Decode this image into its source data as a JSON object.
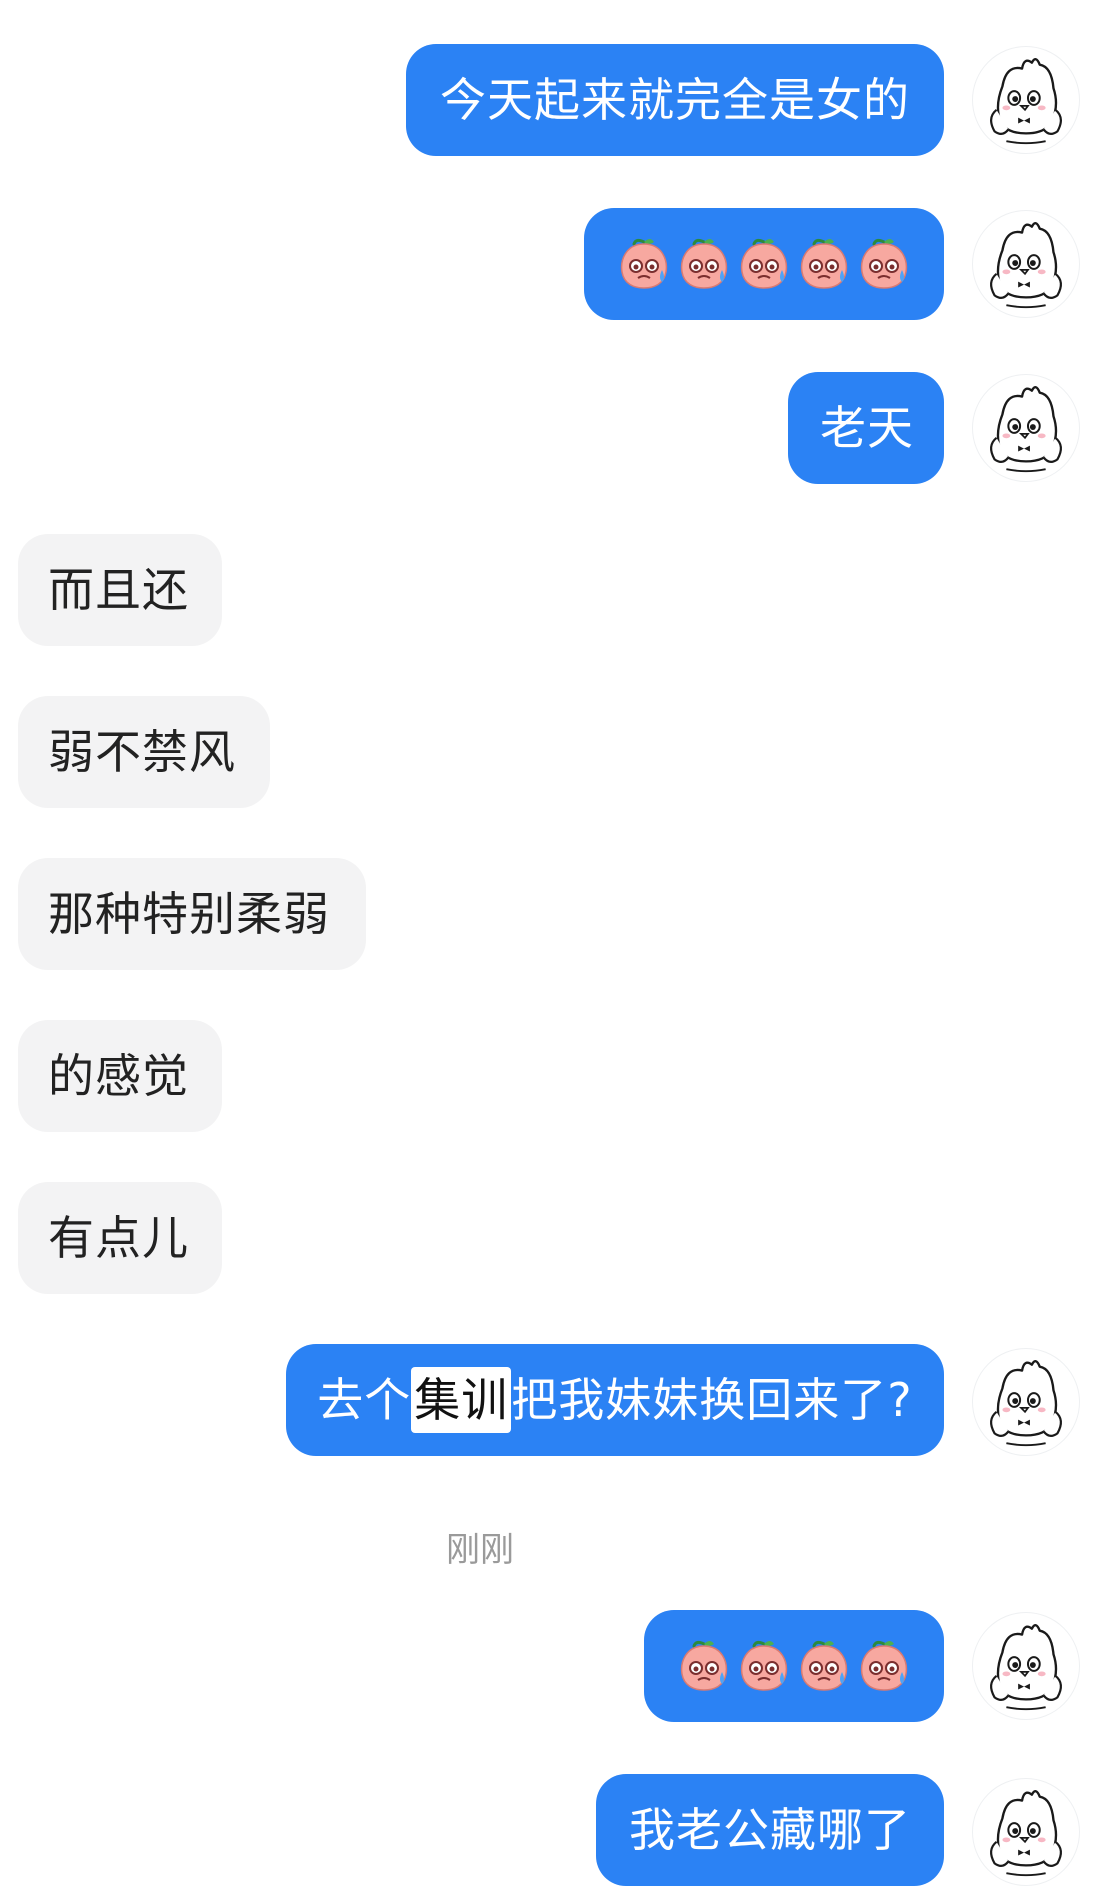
{
  "messages": [
    {
      "side": "out",
      "text": "今天起来就完全是女的"
    },
    {
      "side": "out",
      "emoji": "peach-sweat-emoji",
      "emoji_count": 5
    },
    {
      "side": "out",
      "text": "老天"
    },
    {
      "side": "in",
      "text": "而且还"
    },
    {
      "side": "in",
      "text": "弱不禁风"
    },
    {
      "side": "in",
      "text": "那种特别柔弱"
    },
    {
      "side": "in",
      "text": "的感觉"
    },
    {
      "side": "in",
      "text": "有点儿"
    },
    {
      "side": "out",
      "text_before": "去个",
      "text_highlight": "集训",
      "text_after": "把我妹妹换回来了?"
    },
    {
      "side": "out",
      "emoji": "peach-sweat-emoji",
      "emoji_count": 4
    },
    {
      "side": "out",
      "text": "我老公藏哪了"
    }
  ],
  "timestamp": "刚刚",
  "colors": {
    "outgoing_bubble": "#2b82f4",
    "incoming_bubble": "#f3f3f4",
    "highlight": "#ffffff"
  }
}
